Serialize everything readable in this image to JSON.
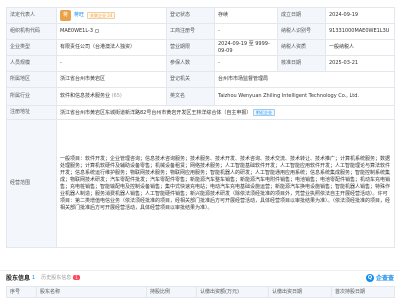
{
  "rows": {
    "legal_rep_label": "法定代表人",
    "legal_rep_avatar": "蒋",
    "legal_rep_name": "蒋旺",
    "legal_rep_tag": "关联企业 24",
    "reg_status_label": "登记状态",
    "reg_status_value": "存续",
    "est_date_label": "成立日期",
    "est_date_value": "2024-09-19",
    "org_code_label": "组织机构代码",
    "org_code_value": "MAE0WE1L-3",
    "biz_reg_no_label": "工商注册号",
    "biz_reg_no_value": "-",
    "taxpayer_id_label": "纳税人识别号",
    "taxpayer_id_value": "91331000MAE0WE1L3U",
    "company_type_label": "企业类型",
    "company_type_value": "有限责任公司（台港澳法人独资）",
    "op_term_label": "营业期限",
    "op_term_value": "2024-09-19 至 9999-09-09",
    "taxpayer_qual_label": "纳税人资质",
    "taxpayer_qual_value": "一般纳税人",
    "staff_label": "人员规模",
    "staff_value": "-",
    "insured_label": "参保人数",
    "insured_value": "-",
    "approval_date_label": "核准日期",
    "approval_date_value": "2025-03-21",
    "region_label": "所属地区",
    "region_value": "浙江省台州市黄岩区",
    "authority_label": "登记机关",
    "authority_value": "台州市市场监督管理局",
    "industry_label": "所属行业",
    "industry_value": "软件和信息技术服务业",
    "industry_code": "(65)",
    "en_name_label": "英文名",
    "en_name_value": "Taizhou Wenyuan Zhiling Intelligent Technology Co., Ltd.",
    "address_label": "注册地址",
    "address_value": "浙江省台州市黄岩区东城街道新洋路82号台州市黄岩开发区王林洋综合体（自主申报）",
    "address_link": "附近企业",
    "scope_label": "经营范围",
    "scope_value": "一般项目：软件开发；企业管理咨询；信息技术咨询服务；技术服务、技术开发、技术咨询、技术交流、技术转让、技术推广；计算机系统服务；数据处理服务；计算机软硬件及辅助设备零售；机械设备租赁；网络技术服务；人工智能基础软件开发；人工智能应用软件开发；人工智能理论与算法软件开发；信息系统运行维护服务；物联网技术服务；物联网应用服务；智能机器人的研发；人工智能通用应用系统；信息系统集成服务；智能控制系统集成；物联网技术研发；汽车零配件批发；汽车零配件零售；新能源汽车整车销售；新能源汽车电附件销售；电池销售；电池零配件销售；机动车充电销售；充电桩销售；智能输配电及控制设备销售；集中式快速充电站；电动汽车充电基础设施运营；新能源汽车换电设施销售；智能机器人销售；特殊作业机器人制造；服务消费机器人销售；人工智能硬件销售；新兴能源技术研发（除依法须经批准的项目外，凭营业执照依法自主开展经营活动）。许可项目：第二类增值电信业务（依法须经批准的项目，经相关部门批准后方可开展经营活动，具体经营项目以审批结果为准）。（依法须经批准的项目，经相关部门批准后方可开展经营活动，具体经营项目以审批结果为准）。"
  },
  "shareholders": {
    "title": "股东信息",
    "count": "1",
    "history_label": "历史股东信息",
    "history_count": "1",
    "brand": "企查查",
    "brand_logo": "Q",
    "columns": [
      "序号",
      "股东名称",
      "持股比例",
      "认缴出资额(万元)",
      "认缴出资日期",
      "首次持股日期"
    ]
  }
}
